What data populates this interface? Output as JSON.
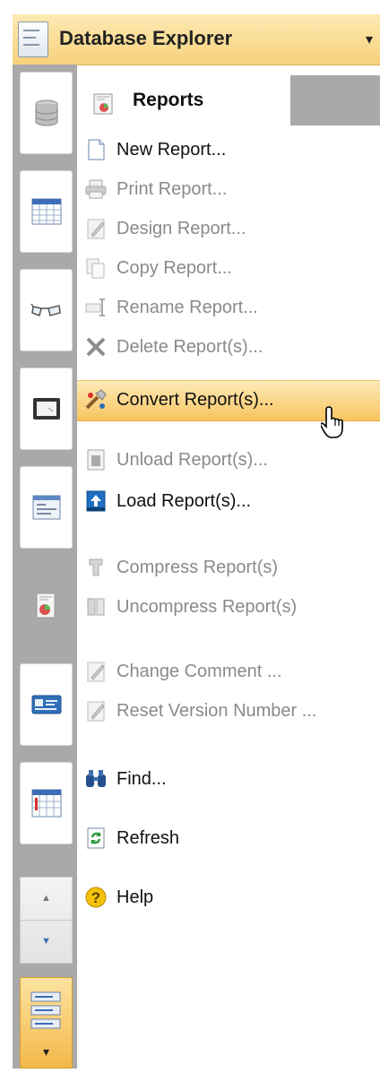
{
  "header": {
    "title": "Database Explorer",
    "dropdown_glyph": "▾"
  },
  "tab": {
    "label": "Reports"
  },
  "menu": {
    "items": [
      {
        "label": "New Report...",
        "enabled": true,
        "icon": "new-report-icon"
      },
      {
        "label": "Print Report...",
        "enabled": false,
        "icon": "printer-icon"
      },
      {
        "label": "Design Report...",
        "enabled": false,
        "icon": "design-pencil-icon"
      },
      {
        "label": "Copy Report...",
        "enabled": false,
        "icon": "copy-icon"
      },
      {
        "label": "Rename Report...",
        "enabled": false,
        "icon": "rename-icon"
      },
      {
        "label": "Delete Report(s)...",
        "enabled": false,
        "icon": "delete-x-icon"
      },
      {
        "label": "Convert Report(s)...",
        "enabled": true,
        "highlighted": true,
        "icon": "convert-tools-icon"
      },
      {
        "label": "Unload Report(s)...",
        "enabled": false,
        "icon": "unload-icon"
      },
      {
        "label": "Load Report(s)...",
        "enabled": true,
        "icon": "load-icon"
      },
      {
        "label": "Compress Report(s)",
        "enabled": false,
        "icon": "compress-icon"
      },
      {
        "label": "Uncompress Report(s)",
        "enabled": false,
        "icon": "uncompress-icon"
      },
      {
        "label": "Change Comment ...",
        "enabled": false,
        "icon": "comment-pencil-icon"
      },
      {
        "label": "Reset Version Number ...",
        "enabled": false,
        "icon": "reset-version-icon"
      },
      {
        "label": "Find...",
        "enabled": true,
        "icon": "binoculars-icon"
      },
      {
        "label": "Refresh",
        "enabled": true,
        "icon": "refresh-icon"
      },
      {
        "label": "Help",
        "enabled": true,
        "icon": "help-icon"
      }
    ]
  },
  "sidebar": {
    "buttons": [
      {
        "icon": "database-icon"
      },
      {
        "icon": "table-icon"
      },
      {
        "icon": "glasses-icon"
      },
      {
        "icon": "form-icon"
      },
      {
        "icon": "window-icon"
      },
      {
        "icon": "report-icon"
      },
      {
        "icon": "card-icon"
      },
      {
        "icon": "calendar-icon"
      }
    ],
    "scroll_up_glyph": "▲",
    "scroll_down_glyph": "▼",
    "active_dropdown_glyph": "▾"
  },
  "colors": {
    "highlight": "#f8c55f",
    "header_bg": "#f7d27c",
    "strip_bg": "#a9a9a9",
    "disabled_text": "#8a8a8a"
  }
}
